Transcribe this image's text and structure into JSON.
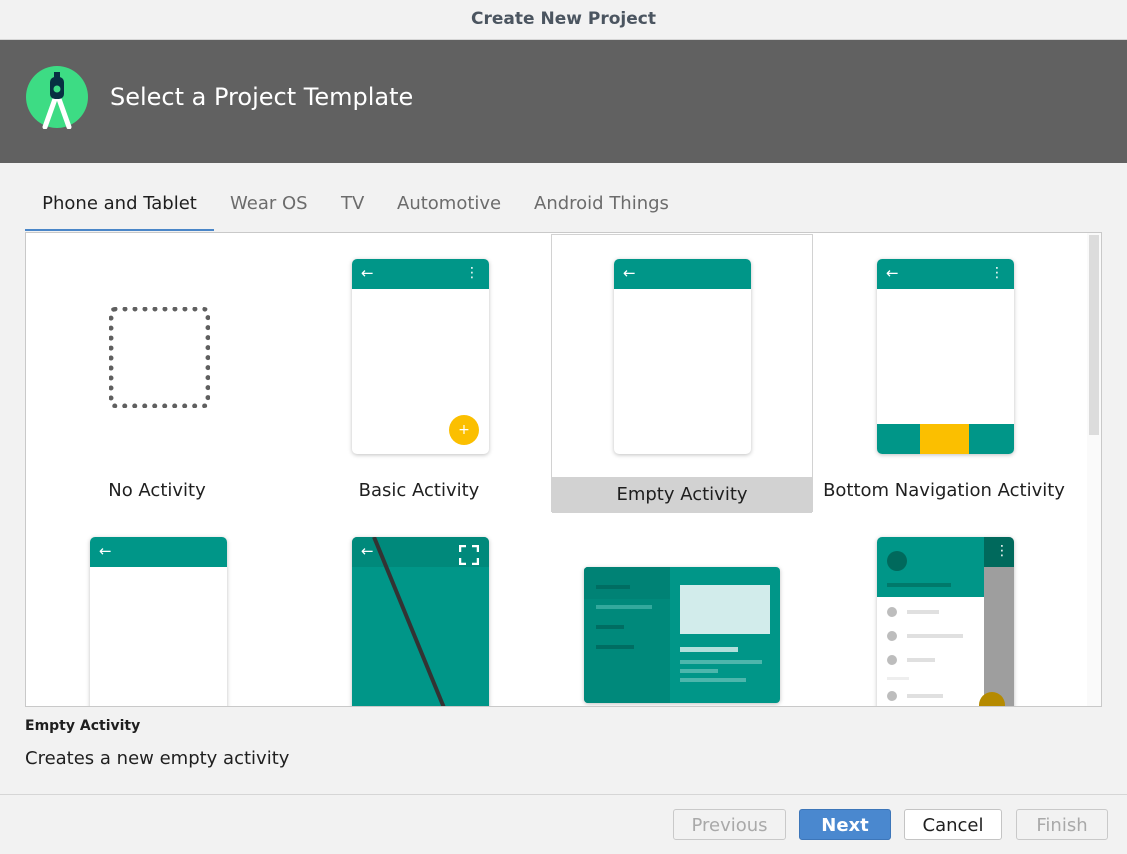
{
  "window": {
    "title": "Create New Project"
  },
  "header": {
    "title": "Select a Project Template",
    "logo_icon": "android-studio-logo-icon"
  },
  "tabs": [
    {
      "label": "Phone and Tablet",
      "active": true
    },
    {
      "label": "Wear OS",
      "active": false
    },
    {
      "label": "TV",
      "active": false
    },
    {
      "label": "Automotive",
      "active": false
    },
    {
      "label": "Android Things",
      "active": false
    }
  ],
  "templates": [
    {
      "label": "No Activity"
    },
    {
      "label": "Basic Activity",
      "fab_symbol": "+"
    },
    {
      "label": "Empty Activity",
      "selected": true
    },
    {
      "label": "Bottom Navigation Activity"
    }
  ],
  "selection": {
    "title": "Empty Activity",
    "description": "Creates a new empty activity"
  },
  "buttons": {
    "previous": "Previous",
    "next": "Next",
    "cancel": "Cancel",
    "finish": "Finish"
  },
  "colors": {
    "teal": "#009688",
    "amber": "#fbbf00",
    "header_bg": "#616161",
    "tab_underline": "#4a86c8",
    "primary_button": "#4a88cf"
  }
}
